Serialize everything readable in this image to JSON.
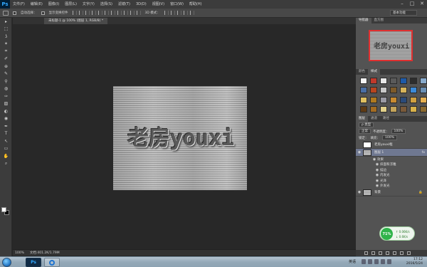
{
  "menubar": {
    "logo": "Ps",
    "items": [
      "文件(F)",
      "编辑(E)",
      "图像(I)",
      "图层(L)",
      "文字(Y)",
      "选择(S)",
      "滤镜(T)",
      "3D(D)",
      "视图(V)",
      "窗口(W)",
      "帮助(H)"
    ],
    "min": "–",
    "max": "□",
    "close": "✕"
  },
  "options": {
    "auto_select": "自动选择：",
    "show_transform": "显示变换控件",
    "mode_3d": "3D 模式：",
    "workspace": "基本功能"
  },
  "tools": [
    "▸",
    "⬚",
    "ʖ",
    "✶",
    "⌗",
    "✐",
    "⊕",
    "✎",
    "⚲",
    "◍",
    "✑",
    "▨",
    "◐",
    "◉",
    "✒",
    "T",
    "↖",
    "▭",
    "✋",
    "⌕"
  ],
  "document": {
    "tab_title": "未标题-1 @ 100% (图层 1, RGB/8) *",
    "canvas_text": "老房youxi"
  },
  "statusbar": {
    "zoom": "100%",
    "doc_info": "文档:401.2K/1.79M"
  },
  "navigator": {
    "tabs": [
      "导航器",
      "直方图"
    ],
    "thumb_text": "老房youxi"
  },
  "styles": {
    "tabs": [
      "颜色",
      "样式"
    ],
    "swatches": [
      "#f4f4f4",
      "#c0392b",
      "#e8e8e8",
      "#5a5a5a",
      "#1e5aa8",
      "#2d2d2d",
      "#88aacc",
      "#4a6fa5",
      "#b8451f",
      "#c9c9c9",
      "#7d5a2a",
      "#d8b45a",
      "#3b8ad9",
      "#6a8fb4",
      "#e0c060",
      "#b07a20",
      "#9a9aa4",
      "#c88a30",
      "#2a4a7a",
      "#d0a040",
      "#e6b050",
      "#5d3a14",
      "#a46c22",
      "#e2d08a",
      "#c4a45a",
      "#7a5a3a",
      "#d9b24a",
      "#8a6a30"
    ]
  },
  "layers": {
    "tabs": [
      "图层",
      "通道",
      "路径"
    ],
    "kind_label": "ρ 类型",
    "blend_mode": "正常",
    "opacity_label": "不透明度：",
    "opacity": "100%",
    "lock_label": "锁定：",
    "fill_label": "填充：",
    "fill": "100%",
    "list": [
      {
        "name": "老房youxi框"
      },
      {
        "name": "图层 1",
        "fx": "fx"
      },
      {
        "name": "背景"
      }
    ],
    "effects_label": "效果",
    "effects": [
      "斜面和浮雕",
      "描边",
      "内发光",
      "光泽",
      "外发光"
    ]
  },
  "speed": {
    "percent": "71%",
    "up": "↑ 0.06K/s",
    "down": "↓ 0.6K/s"
  },
  "taskbar": {
    "ps_label": "Ps",
    "tray_text": "英语",
    "time": "17:12",
    "date": "2016/5/24"
  }
}
